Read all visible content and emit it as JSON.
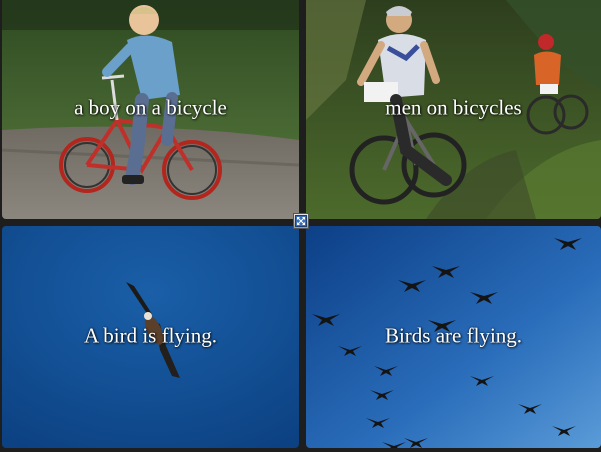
{
  "tiles": [
    {
      "caption": "a boy on a bicycle"
    },
    {
      "caption": "men on bicycles"
    },
    {
      "caption": "A bird is flying."
    },
    {
      "caption": "Birds are flying."
    }
  ],
  "controls": {
    "expand_icon": "expand-arrows-icon"
  },
  "colors": {
    "background": "#1e1e1e",
    "caption_text": "#ffffff",
    "sky_blue": "#0f4f96"
  }
}
